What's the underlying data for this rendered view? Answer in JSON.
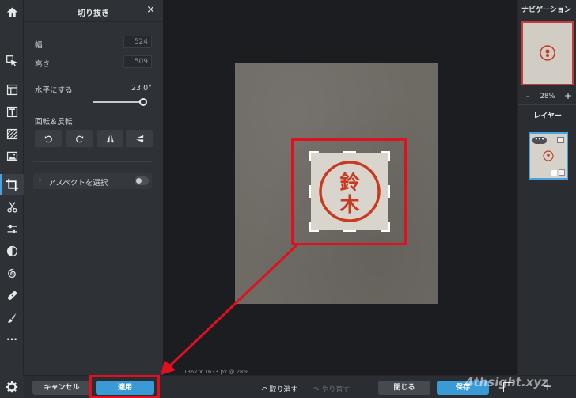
{
  "panel": {
    "title": "切り抜き",
    "close": "×",
    "width_label": "幅",
    "width_value": "524",
    "height_label": "高さ",
    "height_value": "509",
    "straighten_label": "水平にする",
    "straighten_value": "23.0°",
    "straighten_fraction": 0.95,
    "rotate_label": "回転＆反転",
    "aspect_chevron": "›",
    "aspect_label": "アスペクトを選択",
    "aspect_enabled": false
  },
  "toolbar": {
    "active_tool": "crop-tool",
    "tools": [
      "home-icon",
      "select-icon",
      "layout-icon",
      "text-icon",
      "pattern-icon",
      "image-icon",
      "crop-icon",
      "cut-icon",
      "adjust-icon",
      "contrast-icon",
      "spiral-icon",
      "bandage-icon",
      "brush-icon",
      "more-icon",
      "gear-icon"
    ],
    "more": "···"
  },
  "canvas": {
    "size_readout": "1367 x 1633 px @ 28%",
    "seal_text": [
      "鈴",
      "木"
    ]
  },
  "navigator": {
    "title": "ナビゲーション",
    "zoom_minus": "-",
    "zoom": "28%",
    "zoom_plus": "+"
  },
  "layers": {
    "title": "レイヤー",
    "menu": "•••"
  },
  "bottom": {
    "cancel": "キャンセル",
    "apply": "適用",
    "undo": "取り消す",
    "redo": "やり直す",
    "close": "閉じる",
    "save": "保存",
    "plus": "+"
  },
  "watermark": "4thsight.xyz",
  "colors": {
    "accent": "#3a9ad6",
    "annotation_red": "#e01020",
    "seal_red": "#c63b22"
  }
}
